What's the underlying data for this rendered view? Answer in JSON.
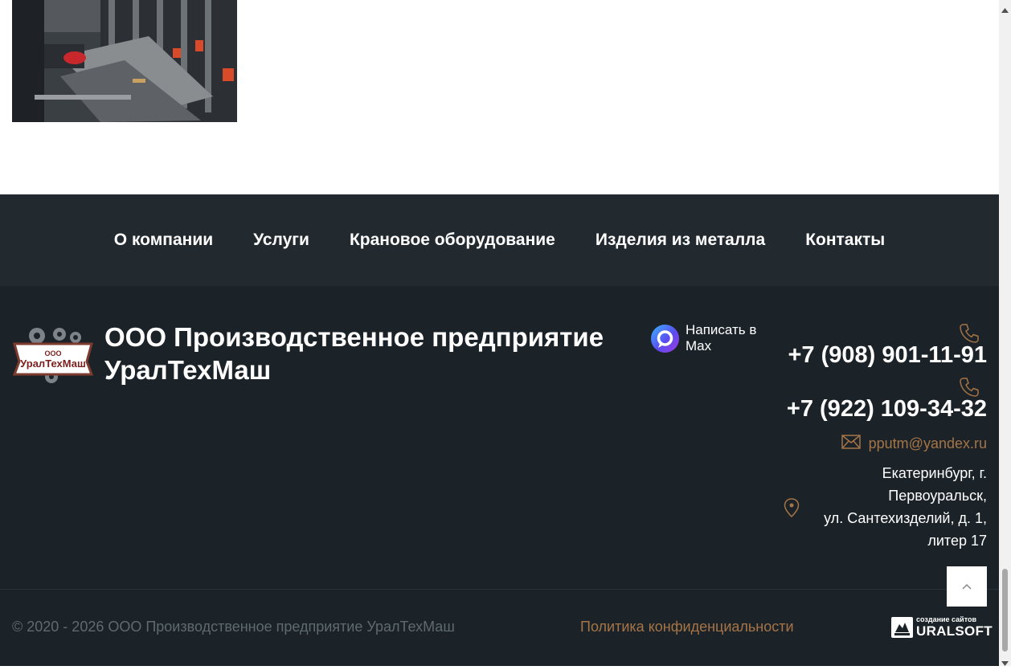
{
  "nav": {
    "items": [
      {
        "label": "О компании"
      },
      {
        "label": "Услуги"
      },
      {
        "label": "Крановое оборудование"
      },
      {
        "label": "Изделия из металла"
      },
      {
        "label": "Контакты"
      }
    ]
  },
  "footer": {
    "logo_text_top": "ООО",
    "logo_text_main": "УралТехМаш",
    "company_name": "ООО Производственное предприятие УралТехМаш",
    "messenger_label": "Написать в Max",
    "phones": [
      "+7 (908) 901-11-91",
      "+7 (922) 109-34-32"
    ],
    "email": "pputm@yandex.ru",
    "address_lines": [
      "Екатеринбург, г.",
      "Первоуральск,",
      "ул. Сантехизделий, д. 1,",
      "литер 17"
    ],
    "copyright": "© 2020 - 2026 ООО Производственное предприятие УралТехМаш",
    "privacy_link": "Политика конфиденциальности",
    "developer_small": "создание сайтов",
    "developer_name": "URALSOFT"
  },
  "colors": {
    "nav_bg": "#222a2f",
    "footer_bg": "#1b2328",
    "accent": "#a57447"
  },
  "icons": [
    "phone-icon",
    "mail-icon",
    "map-pin-icon",
    "max-messenger-icon",
    "chevron-up-icon",
    "uralsoft-logo-icon"
  ]
}
